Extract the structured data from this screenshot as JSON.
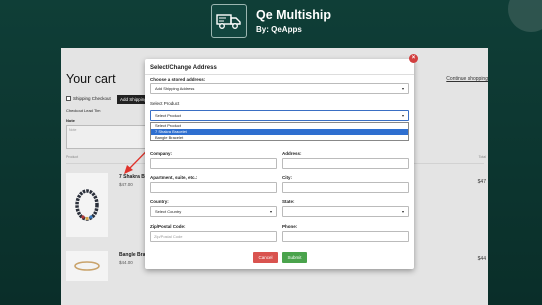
{
  "header": {
    "title": "Qe Multiship",
    "subtitle": "By: QeApps"
  },
  "cart": {
    "title": "Your cart",
    "continue_link": "Continue shopping",
    "shipping_checkbox_label": "Shipping Checkout",
    "add_shipping_button": "Add Shipping",
    "checkout_label": "Checkout Lead Tim",
    "note_label": "Note",
    "note_placeholder": "Note",
    "col_product": "Product",
    "col_total": "Total",
    "products": [
      {
        "name": "7 Shakra B",
        "price": "$47.00",
        "total": "$47"
      },
      {
        "name": "Bangle Bra",
        "price": "$44.00",
        "total": "$44"
      }
    ]
  },
  "modal": {
    "title": "Select/Change Address",
    "stored_label": "Choose a stored address:",
    "stored_value": "Add Shipping Address",
    "product_label": "Select Product",
    "product_value": "Select Product",
    "product_options": [
      "Select Product",
      "7 Shakra Bracelet",
      "Bangle Bracelet"
    ],
    "product_selected_index": 1,
    "company_label": "Company:",
    "address_label": "Address:",
    "apartment_label": "Apartment, suite, etc.:",
    "city_label": "City:",
    "country_label": "Country:",
    "country_value": "Select Country",
    "state_label": "State:",
    "state_value": "",
    "zip_label": "Zip/Postal Code:",
    "zip_placeholder": "Zip/Postal Code",
    "phone_label": "Phone:",
    "cancel_label": "Cancel",
    "submit_label": "Submit",
    "close_glyph": "×"
  },
  "colors": {
    "accent_red": "#d9534f",
    "accent_green": "#4aa34c",
    "selection_blue": "#2e6fd0",
    "background": "#0f3e37"
  }
}
